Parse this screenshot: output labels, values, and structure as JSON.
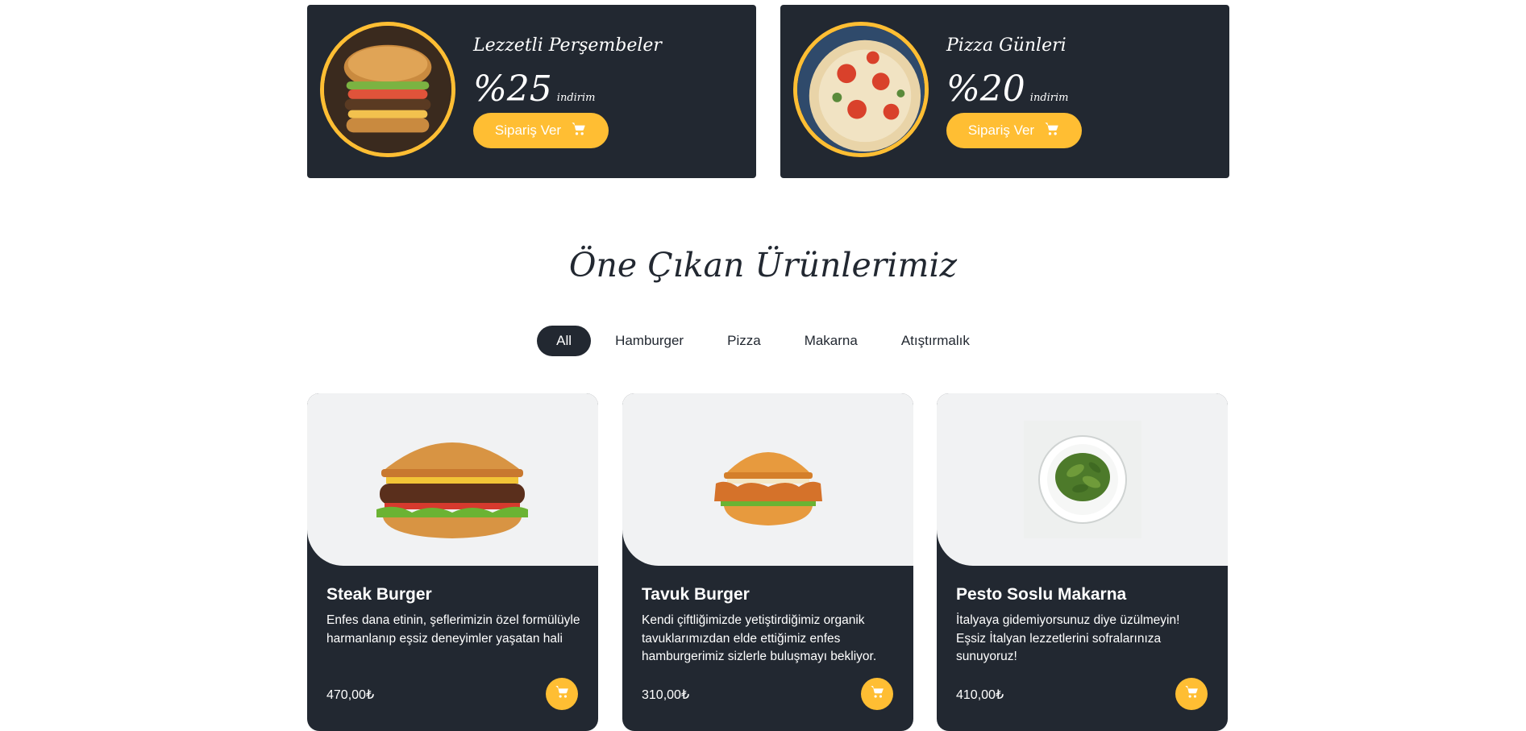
{
  "offers": [
    {
      "title": "Lezzetli Perşembeler",
      "amount": "%25",
      "unit": "indirim",
      "button": "Sipariş Ver",
      "image": "burger-photo"
    },
    {
      "title": "Pizza Günleri",
      "amount": "%20",
      "unit": "indirim",
      "button": "Sipariş Ver",
      "image": "pizza-photo"
    }
  ],
  "section": {
    "title": "Öne Çıkan Ürünlerimiz"
  },
  "filters": [
    "All",
    "Hamburger",
    "Pizza",
    "Makarna",
    "Atıştırmalık"
  ],
  "products": [
    {
      "name": "Steak Burger",
      "description": "Enfes dana etinin, şeflerimizin özel formülüyle harmanlanıp eşsiz deneyimler yaşatan hali",
      "price": "470,00₺",
      "image": "steak-burger-photo"
    },
    {
      "name": "Tavuk Burger",
      "description": "Kendi çiftliğimizde yetiştirdiğimiz organik tavuklarımızdan elde ettiğimiz enfes hamburgerimiz sizlerle buluşmayı bekliyor.",
      "price": "310,00₺",
      "image": "chicken-burger-photo"
    },
    {
      "name": "Pesto Soslu Makarna",
      "description": "İtalyaya gidemiyorsunuz diye üzülmeyin! Eşsiz İtalyan lezzetlerini sofralarınıza sunuyoruz!",
      "price": "410,00₺",
      "image": "pesto-pasta-photo"
    }
  ],
  "colors": {
    "dark": "#222831",
    "accent": "#ffbe33",
    "card_top": "#f1f2f3"
  },
  "icons": {
    "cart": "cart-icon"
  }
}
